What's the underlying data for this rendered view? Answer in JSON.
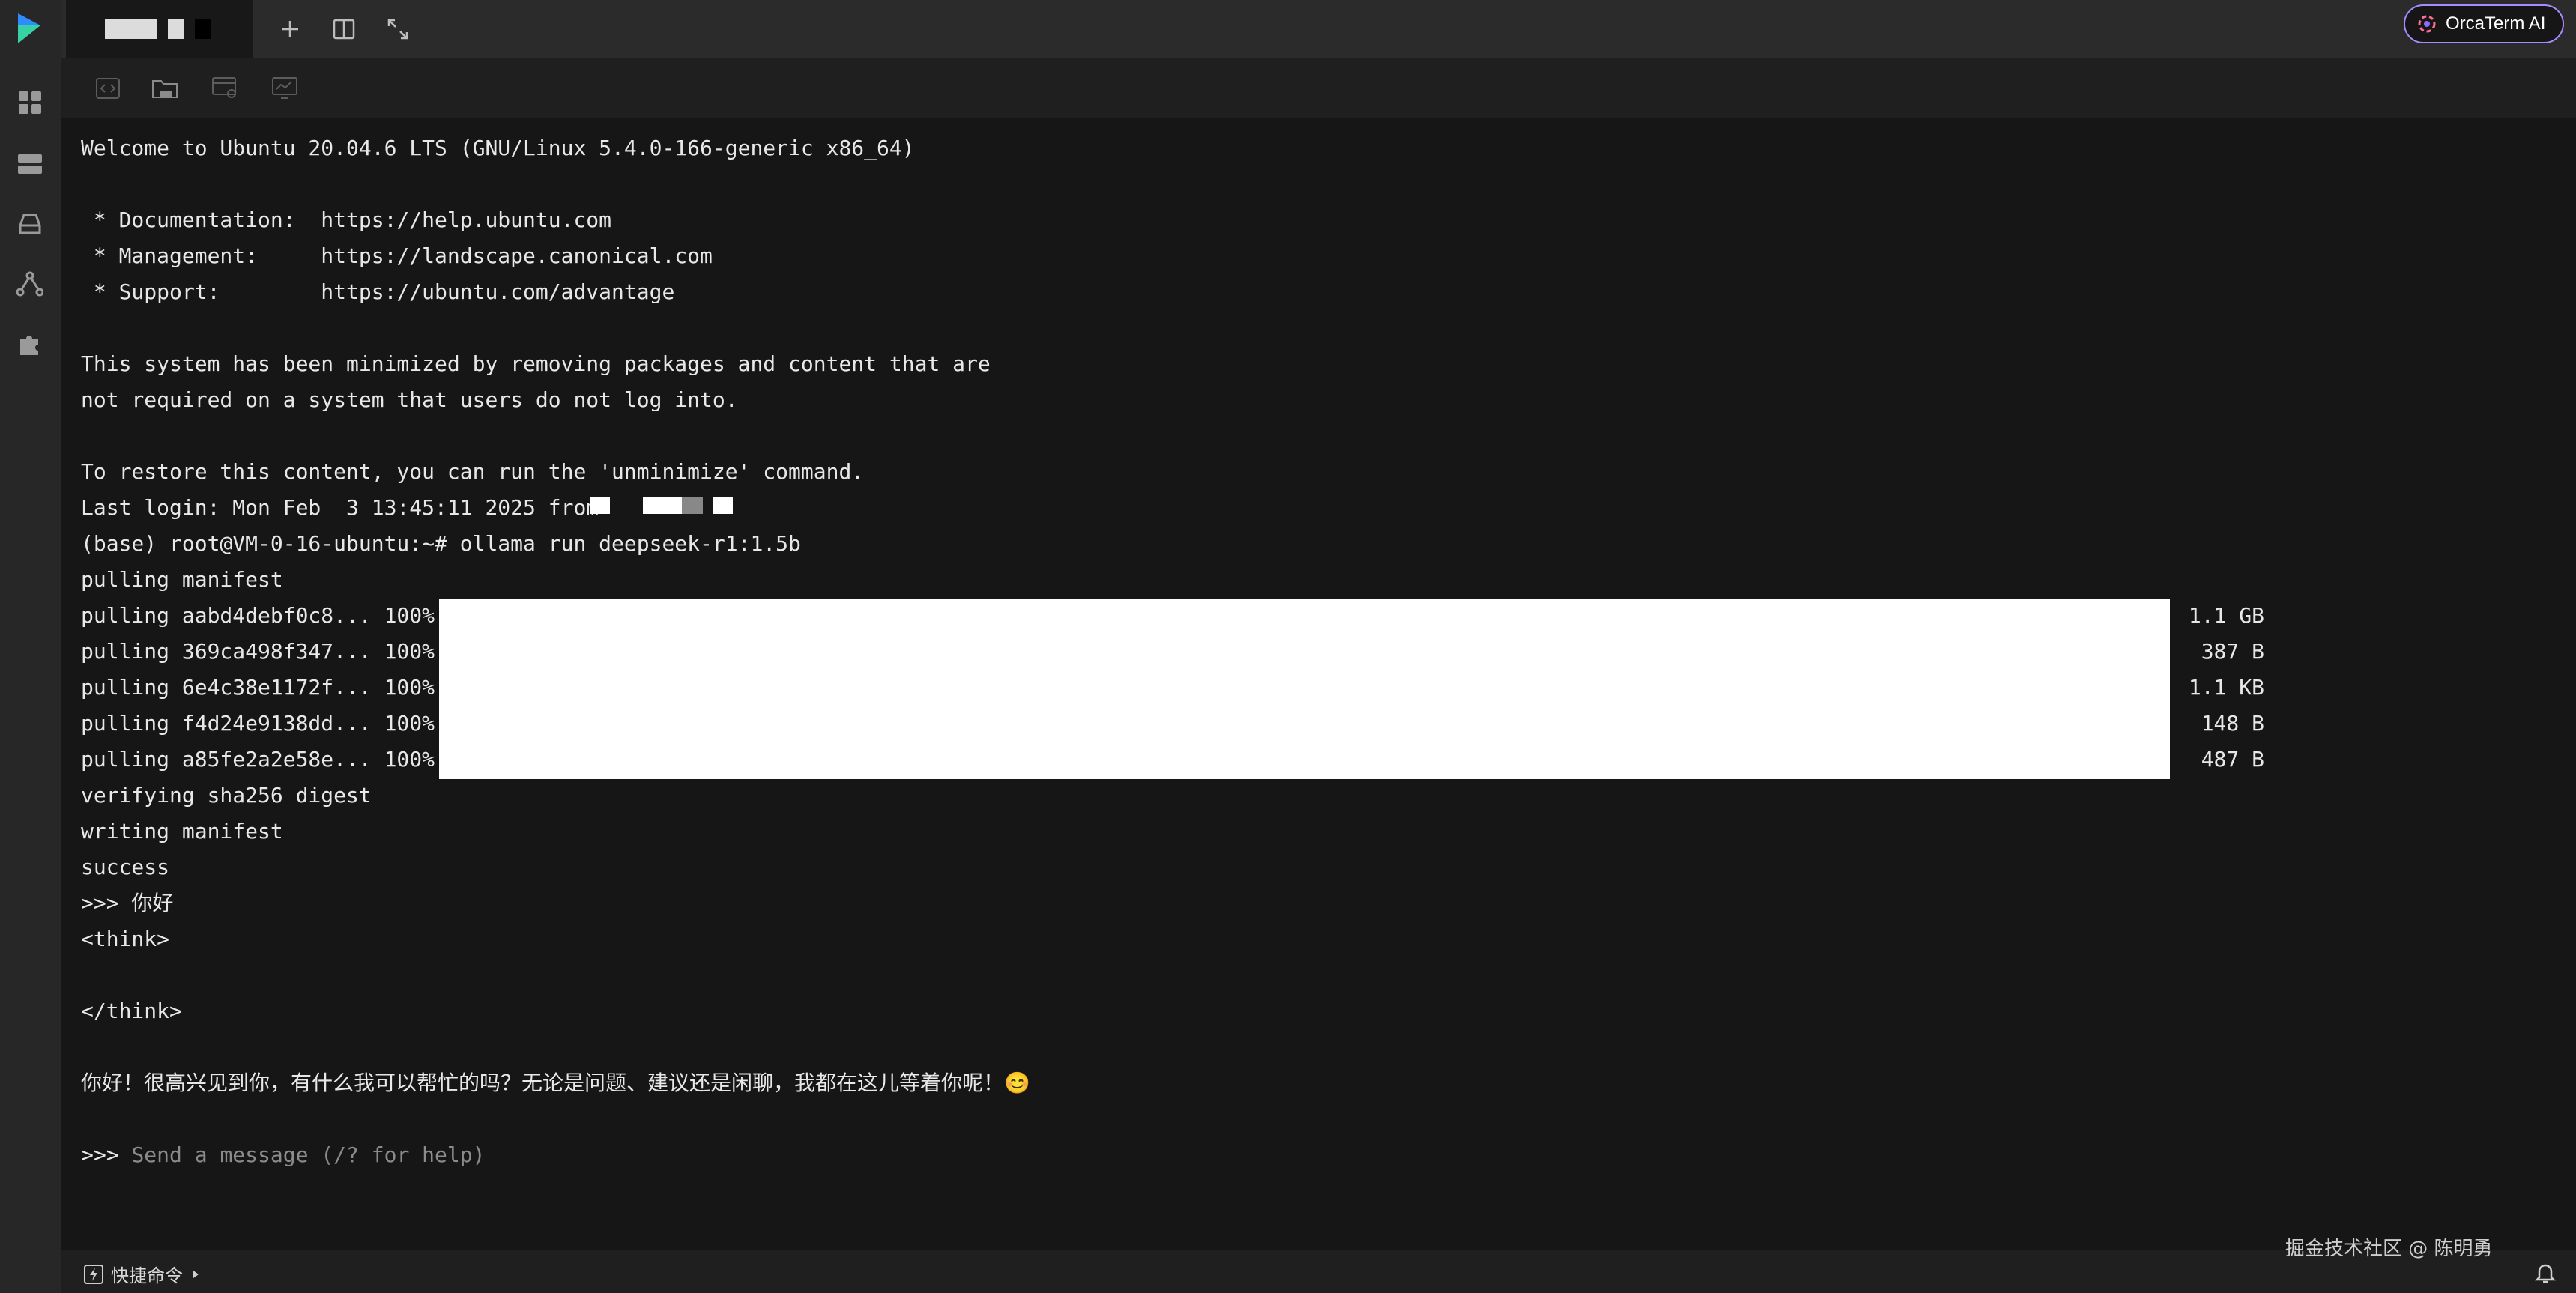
{
  "topbar": {
    "orca_label": "OrcaTerm AI"
  },
  "terminal": {
    "lines": [
      "Welcome to Ubuntu 20.04.6 LTS (GNU/Linux 5.4.0-166-generic x86_64)",
      "",
      " * Documentation:  https://help.ubuntu.com",
      " * Management:     https://landscape.canonical.com",
      " * Support:        https://ubuntu.com/advantage",
      "",
      "This system has been minimized by removing packages and content that are",
      "not required on a system that users do not log into.",
      "",
      "To restore this content, you can run the 'unminimize' command.",
      "Last login: Mon Feb  3 13:45:11 2025 from",
      "(base) root@VM-0-16-ubuntu:~# ollama run deepseek-r1:1.5b",
      "pulling manifest",
      "pulling aabd4debf0c8... 100%",
      "pulling 369ca498f347... 100%",
      "pulling 6e4c38e1172f... 100%",
      "pulling f4d24e9138dd... 100%",
      "pulling a85fe2a2e58e... 100%",
      "verifying sha256 digest",
      "writing manifest",
      "success",
      ">>> 你好",
      "<think>",
      "",
      "</think>",
      "",
      "你好！很高兴见到你，有什么我可以帮忙的吗？无论是问题、建议还是闲聊，我都在这儿等着你呢！😊",
      ""
    ],
    "sizes": [
      "1.1 GB",
      "387 B",
      "1.1 KB",
      "148 B",
      "487 B"
    ],
    "prompt": ">>> ",
    "placeholder": "Send a message (/? for help)"
  },
  "statusbar": {
    "quick_command": "快捷命令",
    "watermark": "掘金技术社区 @ 陈明勇"
  },
  "colors": {
    "accent": "#a98bff",
    "terminal_bg": "#161616",
    "rail_bg": "#272727",
    "topbar_bg": "#2b2b2b"
  }
}
